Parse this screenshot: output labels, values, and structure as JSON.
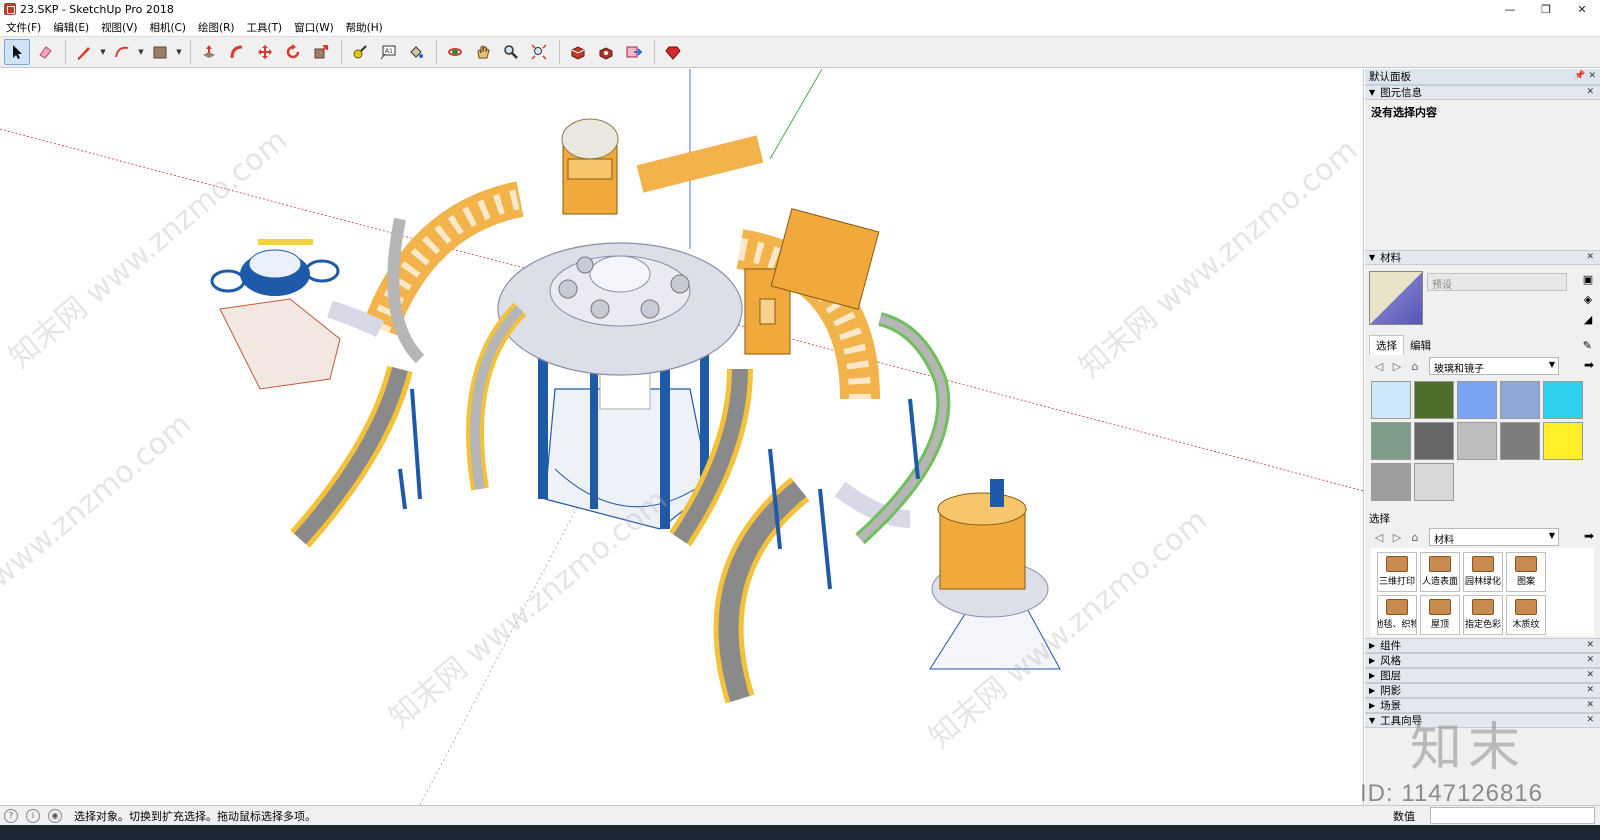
{
  "window": {
    "title": "23.SKP - SketchUp Pro 2018",
    "minimize": "—",
    "maximize": "❐",
    "close": "✕"
  },
  "menu": [
    "文件(F)",
    "编辑(E)",
    "视图(V)",
    "相机(C)",
    "绘图(R)",
    "工具(T)",
    "窗口(W)",
    "帮助(H)"
  ],
  "toolbar": {
    "tools": [
      "select-tool",
      "eraser-tool",
      "line-tool",
      "arc-tool",
      "shape-tool",
      "push-pull-tool",
      "offset-tool",
      "move-tool",
      "rotate-tool",
      "scale-tool",
      "tape-measure-tool",
      "text-tool",
      "paint-bucket-tool",
      "orbit-tool",
      "pan-tool",
      "zoom-tool",
      "zoom-extents-tool",
      "3d-warehouse-tool",
      "extension-warehouse-tool",
      "send-to-layout-tool",
      "extension-manager-tool"
    ]
  },
  "tray": {
    "title": "默认面板",
    "entity_info": {
      "header": "图元信息",
      "content": "没有选择内容"
    },
    "materials": {
      "header": "材料",
      "name_placeholder": "预设",
      "tab_select": "选择",
      "tab_edit": "编辑",
      "library": "玻璃和镜子",
      "swatch_colors": [
        "#cde8f7",
        "#4f6e2a",
        "#7aa3f2",
        "#8ea7d6",
        "#2fd0ef",
        "#7f9c88",
        "#666666",
        "#bdbdbd",
        "#7d7d7d",
        "#ffee2a",
        "#9e9e9e",
        "#d8d8d8"
      ],
      "second_select_label": "选择",
      "second_library": "材料",
      "folders": [
        "三维打印",
        "人造表面",
        "园林绿化",
        "图案",
        "地毯、织物",
        "屋顶",
        "指定色彩",
        "木质纹"
      ]
    },
    "collapsed_sections": [
      "组件",
      "风格",
      "图层",
      "阴影",
      "场景",
      "工具向导"
    ]
  },
  "status": {
    "message": "选择对象。切换到扩充选择。拖动鼠标选择多项。",
    "value_label": "数值",
    "value": ""
  },
  "watermark": {
    "id_text": "ID: 1147126816",
    "logo_text": "知末"
  }
}
